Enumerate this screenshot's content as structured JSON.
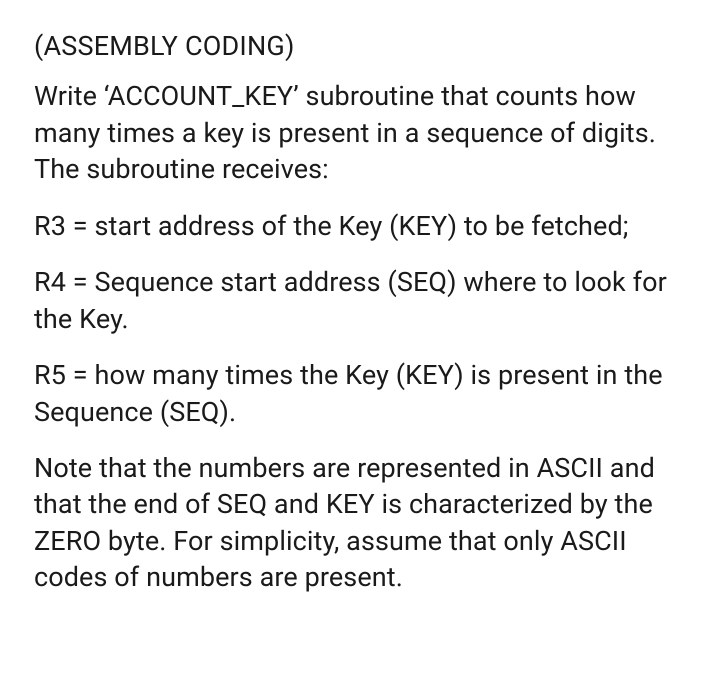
{
  "heading": "(ASSEMBLY CODING)",
  "p1": "Write ‘ACCOUNT_KEY’ subroutine that counts how many times a key is present in a sequence of digits. The subroutine receives:",
  "p2": "R3 = start address of the Key (KEY) to be fetched;",
  "p3": "R4 = Sequence start address (SEQ) where to look for the Key.",
  "p4": "R5 = how many times the Key (KEY) is present in the Sequence (SEQ).",
  "p5": "Note that the numbers are represented in ASCII and that the end of SEQ and KEY is characterized by the ZERO byte. For simplicity, assume that only ASCII codes of numbers are present."
}
